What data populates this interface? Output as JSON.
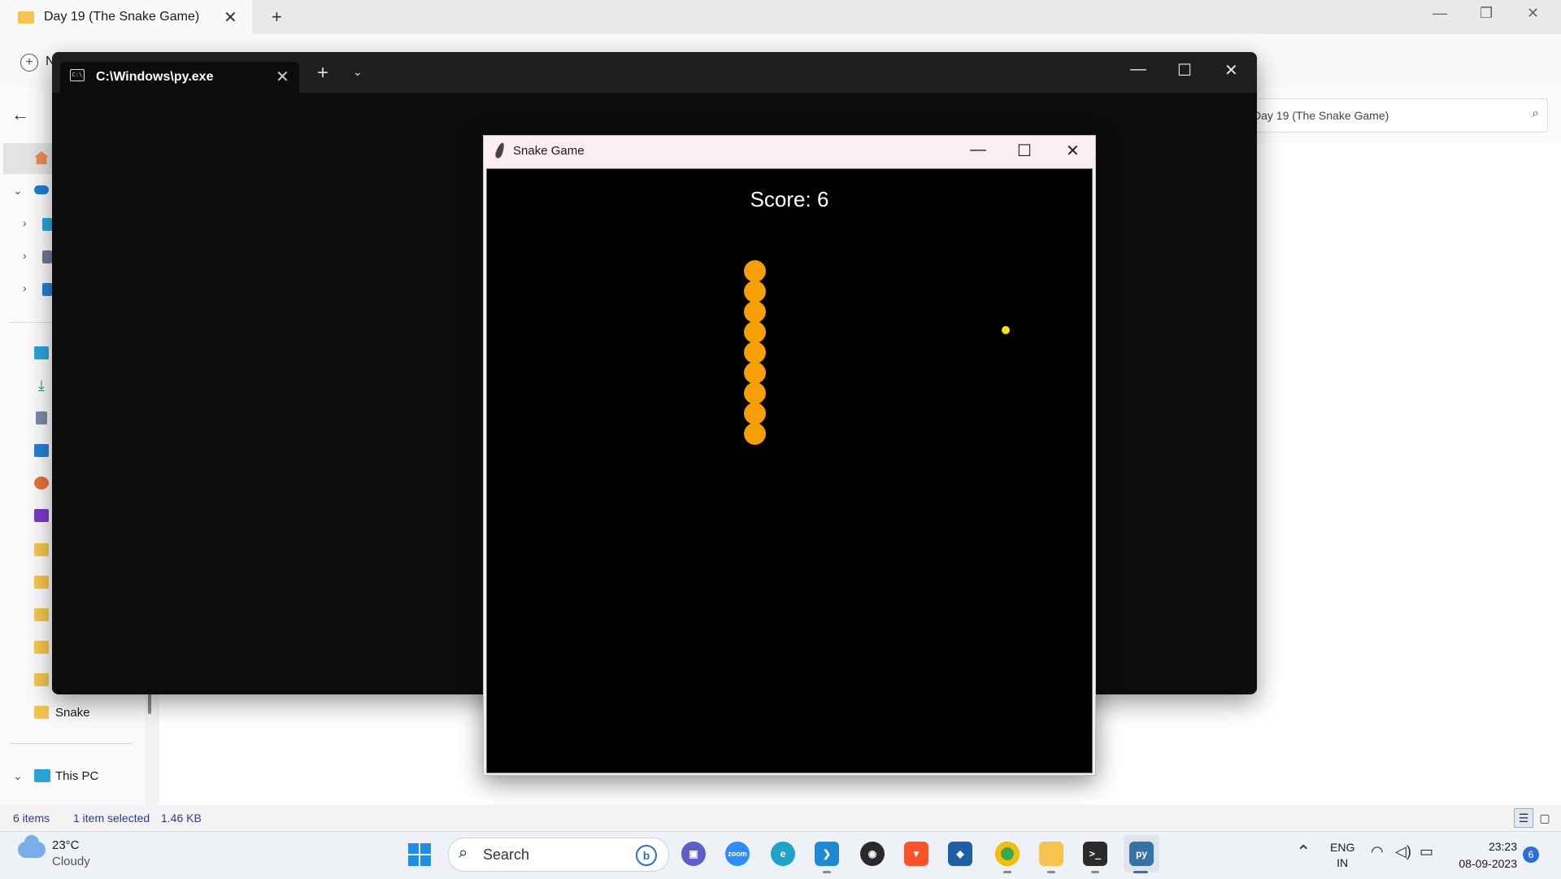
{
  "explorer": {
    "tab_title": "Day 19 (The Snake Game)",
    "new_label": "N",
    "search_text": "Day 19 (The Snake Game)",
    "nav": {
      "snake_folder": "Snake",
      "this_pc": "This PC"
    },
    "status": {
      "items": "6 items",
      "selected": "1 item selected",
      "size": "1.46 KB"
    }
  },
  "terminal": {
    "tab_title": "C:\\Windows\\py.exe"
  },
  "snake_game": {
    "window_title": "Snake Game",
    "score_text": "Score: 6",
    "snake_color": "#f5a000",
    "food_color": "#ffe600",
    "canvas_color": "#000000"
  },
  "taskbar": {
    "weather_temp": "23°C",
    "weather_desc": "Cloudy",
    "search_label": "Search",
    "language_top": "ENG",
    "language_bottom": "IN",
    "time": "23:23",
    "date": "08-09-2023",
    "notification_count": "6",
    "apps": [
      "teams-icon",
      "zoom-icon",
      "edge-icon",
      "vscode-icon",
      "obs-icon",
      "brave-icon",
      "virtualbox-icon",
      "chrome-icon",
      "file-explorer-icon",
      "terminal-icon",
      "python-icon"
    ]
  }
}
